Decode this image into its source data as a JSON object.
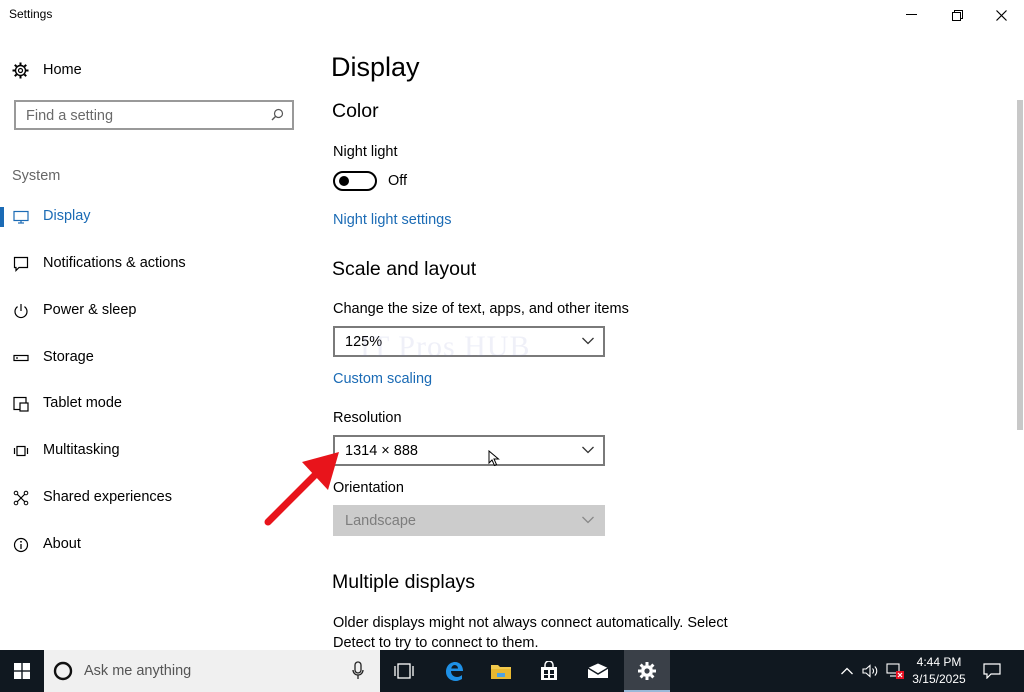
{
  "window": {
    "title": "Settings",
    "minimize_glyph": "—",
    "controls": [
      "minimize-icon",
      "restore-icon",
      "close-icon"
    ]
  },
  "sidebar": {
    "home_label": "Home",
    "search_placeholder": "Find a setting",
    "section_label": "System",
    "items": [
      {
        "label": "Display",
        "icon": "monitor-icon",
        "active": true
      },
      {
        "label": "Notifications & actions",
        "icon": "notification-icon",
        "active": false
      },
      {
        "label": "Power & sleep",
        "icon": "power-icon",
        "active": false
      },
      {
        "label": "Storage",
        "icon": "storage-icon",
        "active": false
      },
      {
        "label": "Tablet mode",
        "icon": "tablet-mode-icon",
        "active": false
      },
      {
        "label": "Multitasking",
        "icon": "multitasking-icon",
        "active": false
      },
      {
        "label": "Shared experiences",
        "icon": "shared-experiences-icon",
        "active": false
      },
      {
        "label": "About",
        "icon": "info-icon",
        "active": false
      }
    ]
  },
  "main": {
    "page_title": "Display",
    "color_heading": "Color",
    "night_light_label": "Night light",
    "night_light_state": "Off",
    "night_light_settings_link": "Night light settings",
    "scale_heading": "Scale and layout",
    "scale_label": "Change the size of text, apps, and other items",
    "scale_value": "125%",
    "custom_scaling_link": "Custom scaling",
    "resolution_label": "Resolution",
    "resolution_value": "1314 × 888",
    "orientation_label": "Orientation",
    "orientation_value": "Landscape",
    "multiple_displays_heading": "Multiple displays",
    "multiple_displays_desc": "Older displays might not always connect automatically. Select Detect to try to connect to them."
  },
  "watermark": "IT Pros HUB",
  "taskbar": {
    "search_placeholder": "Ask me anything",
    "time": "4:44 PM",
    "date": "3/15/2025"
  },
  "colors": {
    "accent": "#1b6bb5",
    "taskbar": "#101820",
    "annotation_arrow": "#e8141b"
  }
}
